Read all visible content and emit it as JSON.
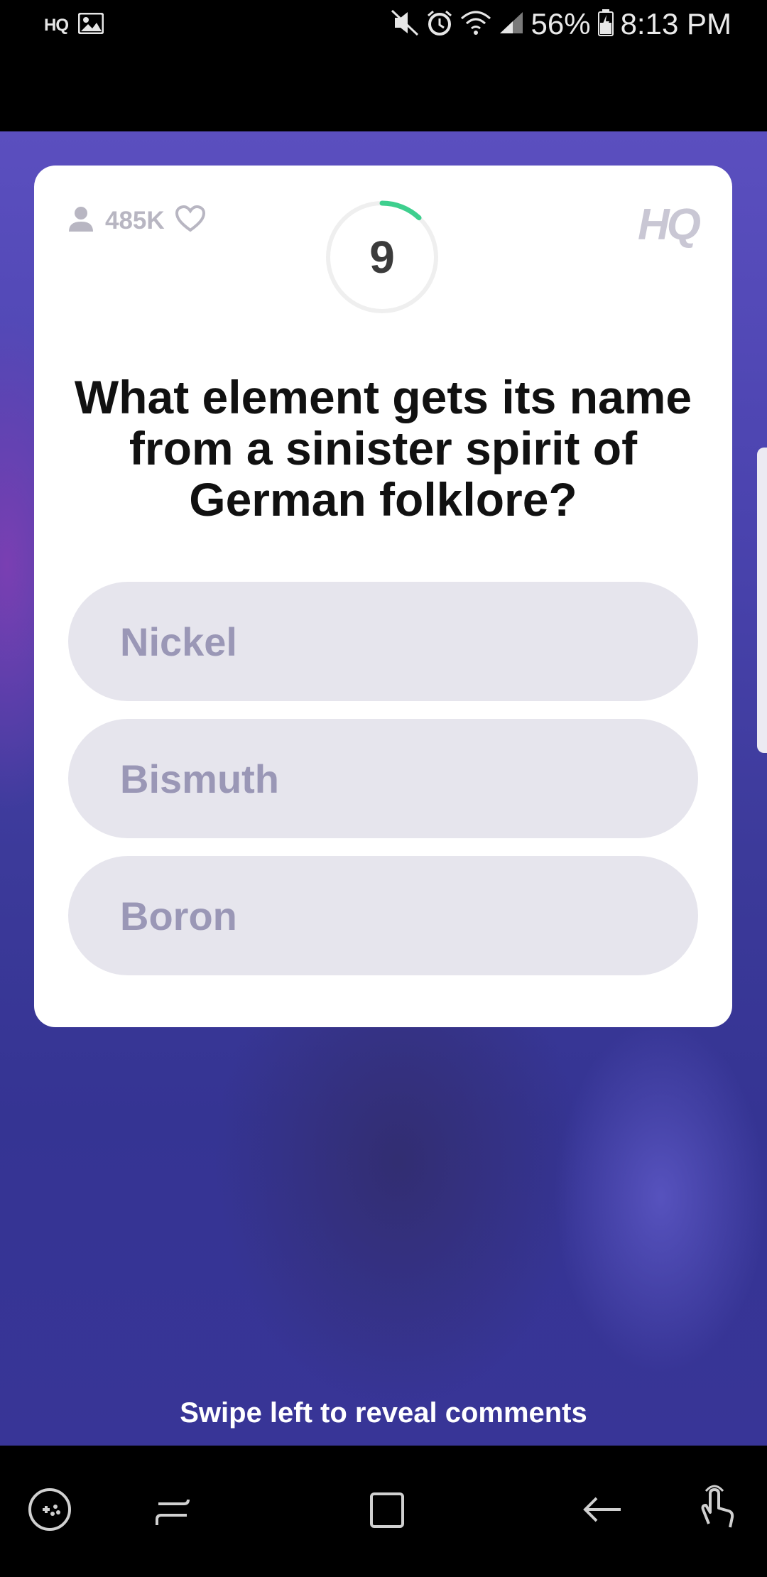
{
  "status_bar": {
    "app_label": "HQ",
    "battery": "56%",
    "time": "8:13 PM",
    "icons": [
      "image-icon",
      "mute-icon",
      "alarm-icon",
      "wifi-icon",
      "signal-icon",
      "battery-icon"
    ]
  },
  "card": {
    "viewer_count": "485K",
    "logo": "HQ",
    "timer": "9",
    "timer_fraction_remaining": 0.12,
    "question": "What element gets its name from a sinister spirit of German folklore?",
    "answers": [
      "Nickel",
      "Bismuth",
      "Boron"
    ]
  },
  "hint": "Swipe left to reveal comments",
  "colors": {
    "card_bg": "#ffffff",
    "answer_bg": "#e6e5ed",
    "answer_text": "#9a97b6",
    "timer_arc": "#3ecf8e",
    "background": "#3c3a9a"
  },
  "nav_bar": {
    "icons": [
      "game-launcher-icon",
      "recent-apps-icon",
      "home-icon",
      "back-icon",
      "gesture-icon"
    ]
  }
}
